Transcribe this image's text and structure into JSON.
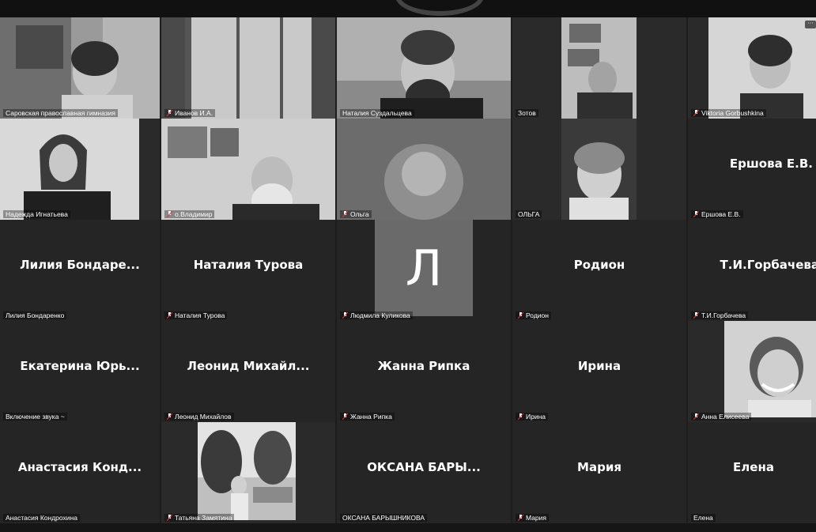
{
  "window": {
    "title": ""
  },
  "tiles": [
    {
      "id": "t1",
      "label": "Саровская православная гимназия",
      "has_video": true,
      "muted": false
    },
    {
      "id": "t2",
      "label": "Иванов И.А.",
      "has_video": true,
      "muted": true
    },
    {
      "id": "t3",
      "label": "Наталия Суздальцева",
      "has_video": true,
      "muted": false,
      "active": true
    },
    {
      "id": "t4",
      "label": "Зотов",
      "has_video": true,
      "muted": false
    },
    {
      "id": "t5",
      "label": "Viktoria Gorbushkina",
      "has_video": true,
      "muted": true
    },
    {
      "id": "t6",
      "label": "Надежда Игнатьева",
      "has_video": true,
      "muted": false
    },
    {
      "id": "t7",
      "label": "о.Владимир",
      "has_video": true,
      "muted": true
    },
    {
      "id": "t8",
      "label": "Ольга",
      "has_video": true,
      "muted": true
    },
    {
      "id": "t9",
      "label": "ОЛЬГА",
      "has_video": true,
      "muted": false
    },
    {
      "id": "t10",
      "big_name": "Ершова Е.В.",
      "label": "Ершова Е.В.",
      "has_video": false,
      "muted": true
    },
    {
      "id": "t11",
      "big_name": "Лилия Бондаре...",
      "label": "Лилия Бондаренко",
      "has_video": false,
      "muted": false
    },
    {
      "id": "t12",
      "big_name": "Наталия Турова",
      "label": "Наталия Турова",
      "has_video": false,
      "muted": true
    },
    {
      "id": "t13",
      "avatar_letter": "Л",
      "label": "Людмила Куликова",
      "has_video": false,
      "muted": true
    },
    {
      "id": "t14",
      "big_name": "Родион",
      "label": "Родион",
      "has_video": false,
      "muted": true
    },
    {
      "id": "t15",
      "big_name": "Т.И.Горбачева",
      "label": "Т.И.Горбачева",
      "has_video": false,
      "muted": true
    },
    {
      "id": "t16",
      "big_name": "Екатерина Юрь...",
      "label": "Включение звука ~",
      "has_video": false,
      "muted": false
    },
    {
      "id": "t17",
      "big_name": "Леонид Михайл...",
      "label": "Леонид Михайлов",
      "has_video": false,
      "muted": true
    },
    {
      "id": "t18",
      "big_name": "Жанна Рипка",
      "label": "Жанна Рипка",
      "has_video": false,
      "muted": true
    },
    {
      "id": "t19",
      "big_name": "Ирина",
      "label": "Ирина",
      "has_video": false,
      "muted": true
    },
    {
      "id": "t20",
      "label": "Анна Елисеева",
      "has_video": true,
      "muted": true
    },
    {
      "id": "t21",
      "big_name": "Анастасия Конд...",
      "label": "Анастасия Кондрохина",
      "has_video": false,
      "muted": false
    },
    {
      "id": "t22",
      "label": "Татьяна Замятина",
      "has_video": true,
      "muted": true
    },
    {
      "id": "t23",
      "big_name": "ОКСАНА БАРЫ...",
      "label": "ОКСАНА БАРЫШНИКОВА",
      "has_video": false,
      "muted": false
    },
    {
      "id": "t24",
      "big_name": "Мария",
      "label": "Мария",
      "has_video": false,
      "muted": true
    },
    {
      "id": "t25",
      "big_name": "Елена",
      "label": "Елена",
      "has_video": false,
      "muted": false
    }
  ],
  "colors": {
    "tile_bg": "#2a2a2a",
    "text": "#ffffff",
    "avatar_bg": "#6a6a6a"
  }
}
